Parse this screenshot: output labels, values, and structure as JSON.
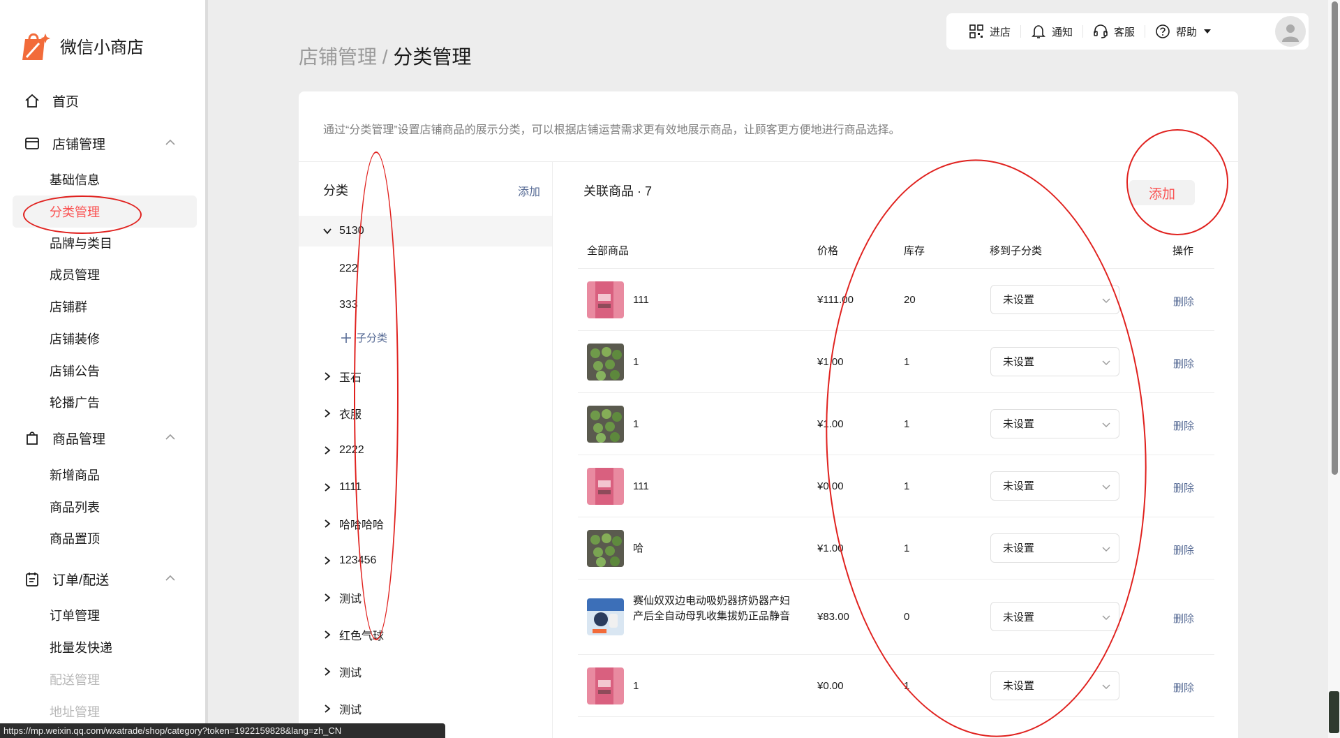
{
  "app": {
    "name": "微信小商店"
  },
  "sidebar": {
    "home": "首页",
    "store_mgmt": "店铺管理",
    "store_sub": [
      "基础信息",
      "分类管理",
      "品牌与类目",
      "成员管理",
      "店铺群",
      "店铺装修",
      "店铺公告",
      "轮播广告"
    ],
    "goods_mgmt": "商品管理",
    "goods_sub": [
      "新增商品",
      "商品列表",
      "商品置顶"
    ],
    "order_mgmt": "订单/配送",
    "order_sub": [
      "订单管理",
      "批量发快递",
      "配送管理",
      "地址管理"
    ]
  },
  "topbar": {
    "enter": "进店",
    "notify": "通知",
    "service": "客服",
    "help": "帮助"
  },
  "breadcrumb": {
    "parent": "店铺管理",
    "sep": " / ",
    "current": "分类管理"
  },
  "description": "通过“分类管理”设置店铺商品的展示分类，可以根据店铺运营需求更有效地展示商品，让顾客更方便地进行商品选择。",
  "categories": {
    "header": "分类",
    "add_label": "添加",
    "selected": "5130",
    "children": [
      "222",
      "333"
    ],
    "add_sub_label": "子分类",
    "others": [
      "玉石",
      "衣服",
      "2222",
      "1111",
      "哈哈哈哈",
      "123456",
      "测试",
      "红色气球",
      "测试",
      "测试"
    ]
  },
  "related": {
    "title": "关联商品 · 7",
    "add_button": "添加",
    "columns": [
      "全部商品",
      "价格",
      "库存",
      "移到子分类",
      "操作"
    ],
    "rows": [
      {
        "name": "111",
        "price": "¥111.00",
        "stock": "20",
        "sub": "未设置",
        "action": "删除",
        "img": "pink"
      },
      {
        "name": "1",
        "price": "¥1.00",
        "stock": "1",
        "sub": "未设置",
        "action": "删除",
        "img": "green"
      },
      {
        "name": "1",
        "price": "¥1.00",
        "stock": "1",
        "sub": "未设置",
        "action": "删除",
        "img": "green"
      },
      {
        "name": "111",
        "price": "¥0.00",
        "stock": "1",
        "sub": "未设置",
        "action": "删除",
        "img": "pink"
      },
      {
        "name": "哈",
        "price": "¥1.00",
        "stock": "1",
        "sub": "未设置",
        "action": "删除",
        "img": "green"
      },
      {
        "name": "赛仙奴双边电动吸奶器挤奶器产妇产后全自动母乳收集拔奶正品静音",
        "price": "¥83.00",
        "stock": "0",
        "sub": "未设置",
        "action": "删除",
        "img": "blue"
      },
      {
        "name": "1",
        "price": "¥0.00",
        "stock": "1",
        "sub": "未设置",
        "action": "删除",
        "img": "pink"
      }
    ]
  },
  "status_url": "https://mp.weixin.qq.com/wxatrade/shop/category?token=1922159828&lang=zh_CN",
  "colors": {
    "accent": "#fa5151",
    "link": "#576b95",
    "annotation": "#e0211e"
  }
}
